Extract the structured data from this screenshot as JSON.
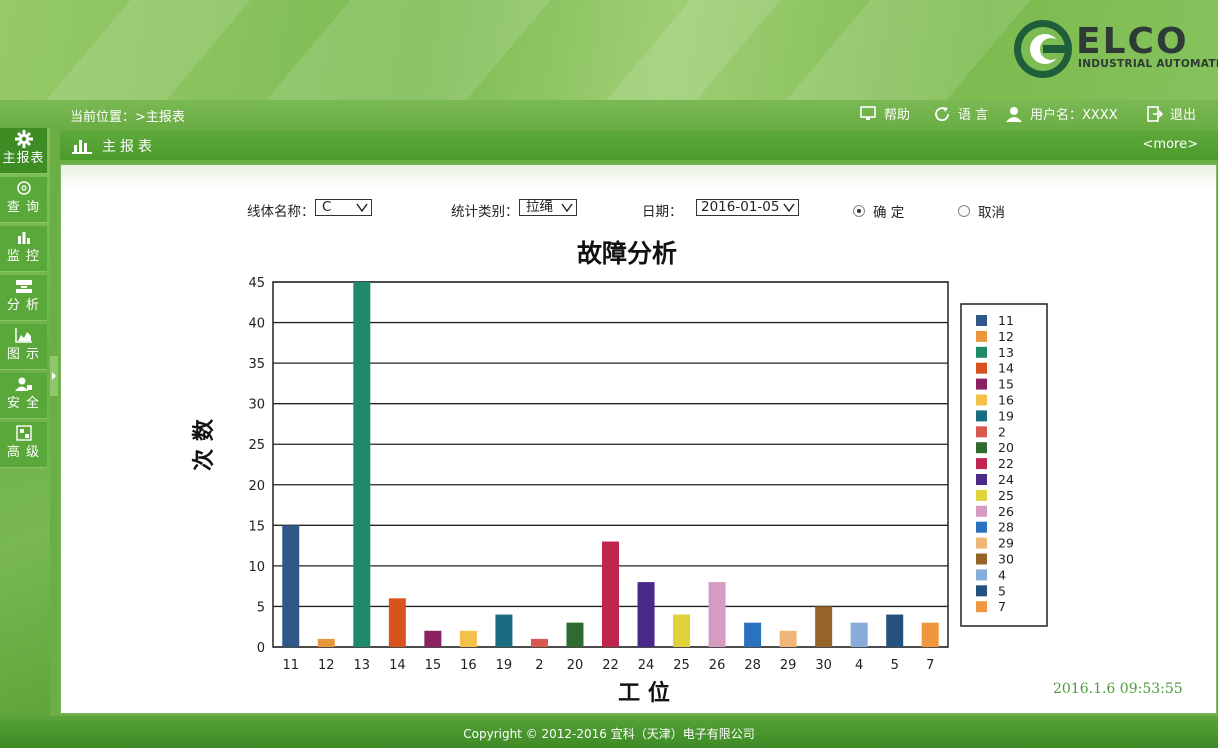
{
  "brand": {
    "name": "ELCO",
    "subtitle": "INDUSTRIAL AUTOMATION"
  },
  "breadcrumb": "当前位置：>主报表",
  "topbar": {
    "help": "帮助",
    "language": "语 言",
    "user": "用户名：XXXX",
    "logout": "退出"
  },
  "sidebar": {
    "items": [
      {
        "label": "主报表",
        "icon": "gear-icon"
      },
      {
        "label": "查 询",
        "icon": "search-icon"
      },
      {
        "label": "监 控",
        "icon": "bar-chart-icon"
      },
      {
        "label": "分 析",
        "icon": "analysis-icon"
      },
      {
        "label": "图 示",
        "icon": "area-chart-icon"
      },
      {
        "label": "安 全",
        "icon": "user-lock-icon"
      },
      {
        "label": "高 级",
        "icon": "advanced-icon"
      }
    ]
  },
  "panel": {
    "title": "主报表",
    "more": "<more>",
    "icon": "bar-chart-icon"
  },
  "form": {
    "line_label": "线体名称：",
    "line_value": "C",
    "type_label": "统计类别：",
    "type_value": "拉绳",
    "date_label": "日期：",
    "date_value": "2016-01-05",
    "confirm": "确 定",
    "cancel": "取消"
  },
  "timestamp": "2016.1.6 09:53:55",
  "footer": "Copyright © 2012-2016 宜科（天津）电子有限公司",
  "colors": {
    "accent": "#5aa33a",
    "timestamp": "#4d9a3a"
  },
  "chart_data": {
    "type": "bar",
    "title": "故障分析",
    "xlabel": "工 位",
    "ylabel": "次 数",
    "ylim": [
      0,
      45
    ],
    "yticks": [
      0,
      5,
      10,
      15,
      20,
      25,
      30,
      35,
      40,
      45
    ],
    "grid": true,
    "legend": "right",
    "categories": [
      "11",
      "12",
      "13",
      "14",
      "15",
      "16",
      "19",
      "2",
      "20",
      "22",
      "24",
      "25",
      "26",
      "28",
      "29",
      "30",
      "4",
      "5",
      "7"
    ],
    "values": [
      15,
      1,
      45,
      6,
      2,
      2,
      4,
      1,
      3,
      13,
      8,
      4,
      8,
      3,
      2,
      5,
      3,
      4,
      3
    ],
    "colors": [
      "#2f5889",
      "#e8973b",
      "#1f8a6a",
      "#d9531e",
      "#8a2160",
      "#f3c04a",
      "#1b6b81",
      "#d8574e",
      "#2f6b30",
      "#c0254f",
      "#4a2a88",
      "#dfd23a",
      "#d79ac2",
      "#2a72bd",
      "#efb67a",
      "#946428",
      "#86acd9",
      "#24517e",
      "#ef9640"
    ]
  }
}
